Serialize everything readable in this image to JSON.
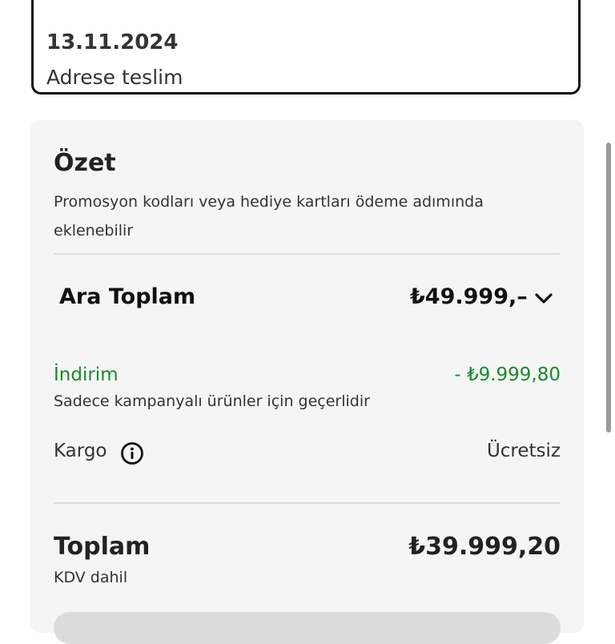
{
  "delivery": {
    "date": "13.11.2024",
    "method": "Adrese teslim"
  },
  "summary": {
    "title": "Özet",
    "promo_note": "Promosyon kodları veya hediye kartları ödeme adımında eklenebilir",
    "subtotal_label": "Ara Toplam",
    "subtotal_value": "₺49.999,–",
    "discount_label": "İndirim",
    "discount_value": "- ₺9.999,80",
    "discount_note": "Sadece kampanyalı ürünler için geçerlidir",
    "shipping_label": "Kargo",
    "shipping_value": "Ücretsiz",
    "total_label": "Toplam",
    "total_value": "₺39.999,20",
    "vat_note": "KDV dahil"
  },
  "colors": {
    "discount_green": "#1a8a2e",
    "card_background": "#f5f5f5"
  },
  "icons": {
    "expand": "chevron-down-icon",
    "shipping_info": "info-icon"
  }
}
